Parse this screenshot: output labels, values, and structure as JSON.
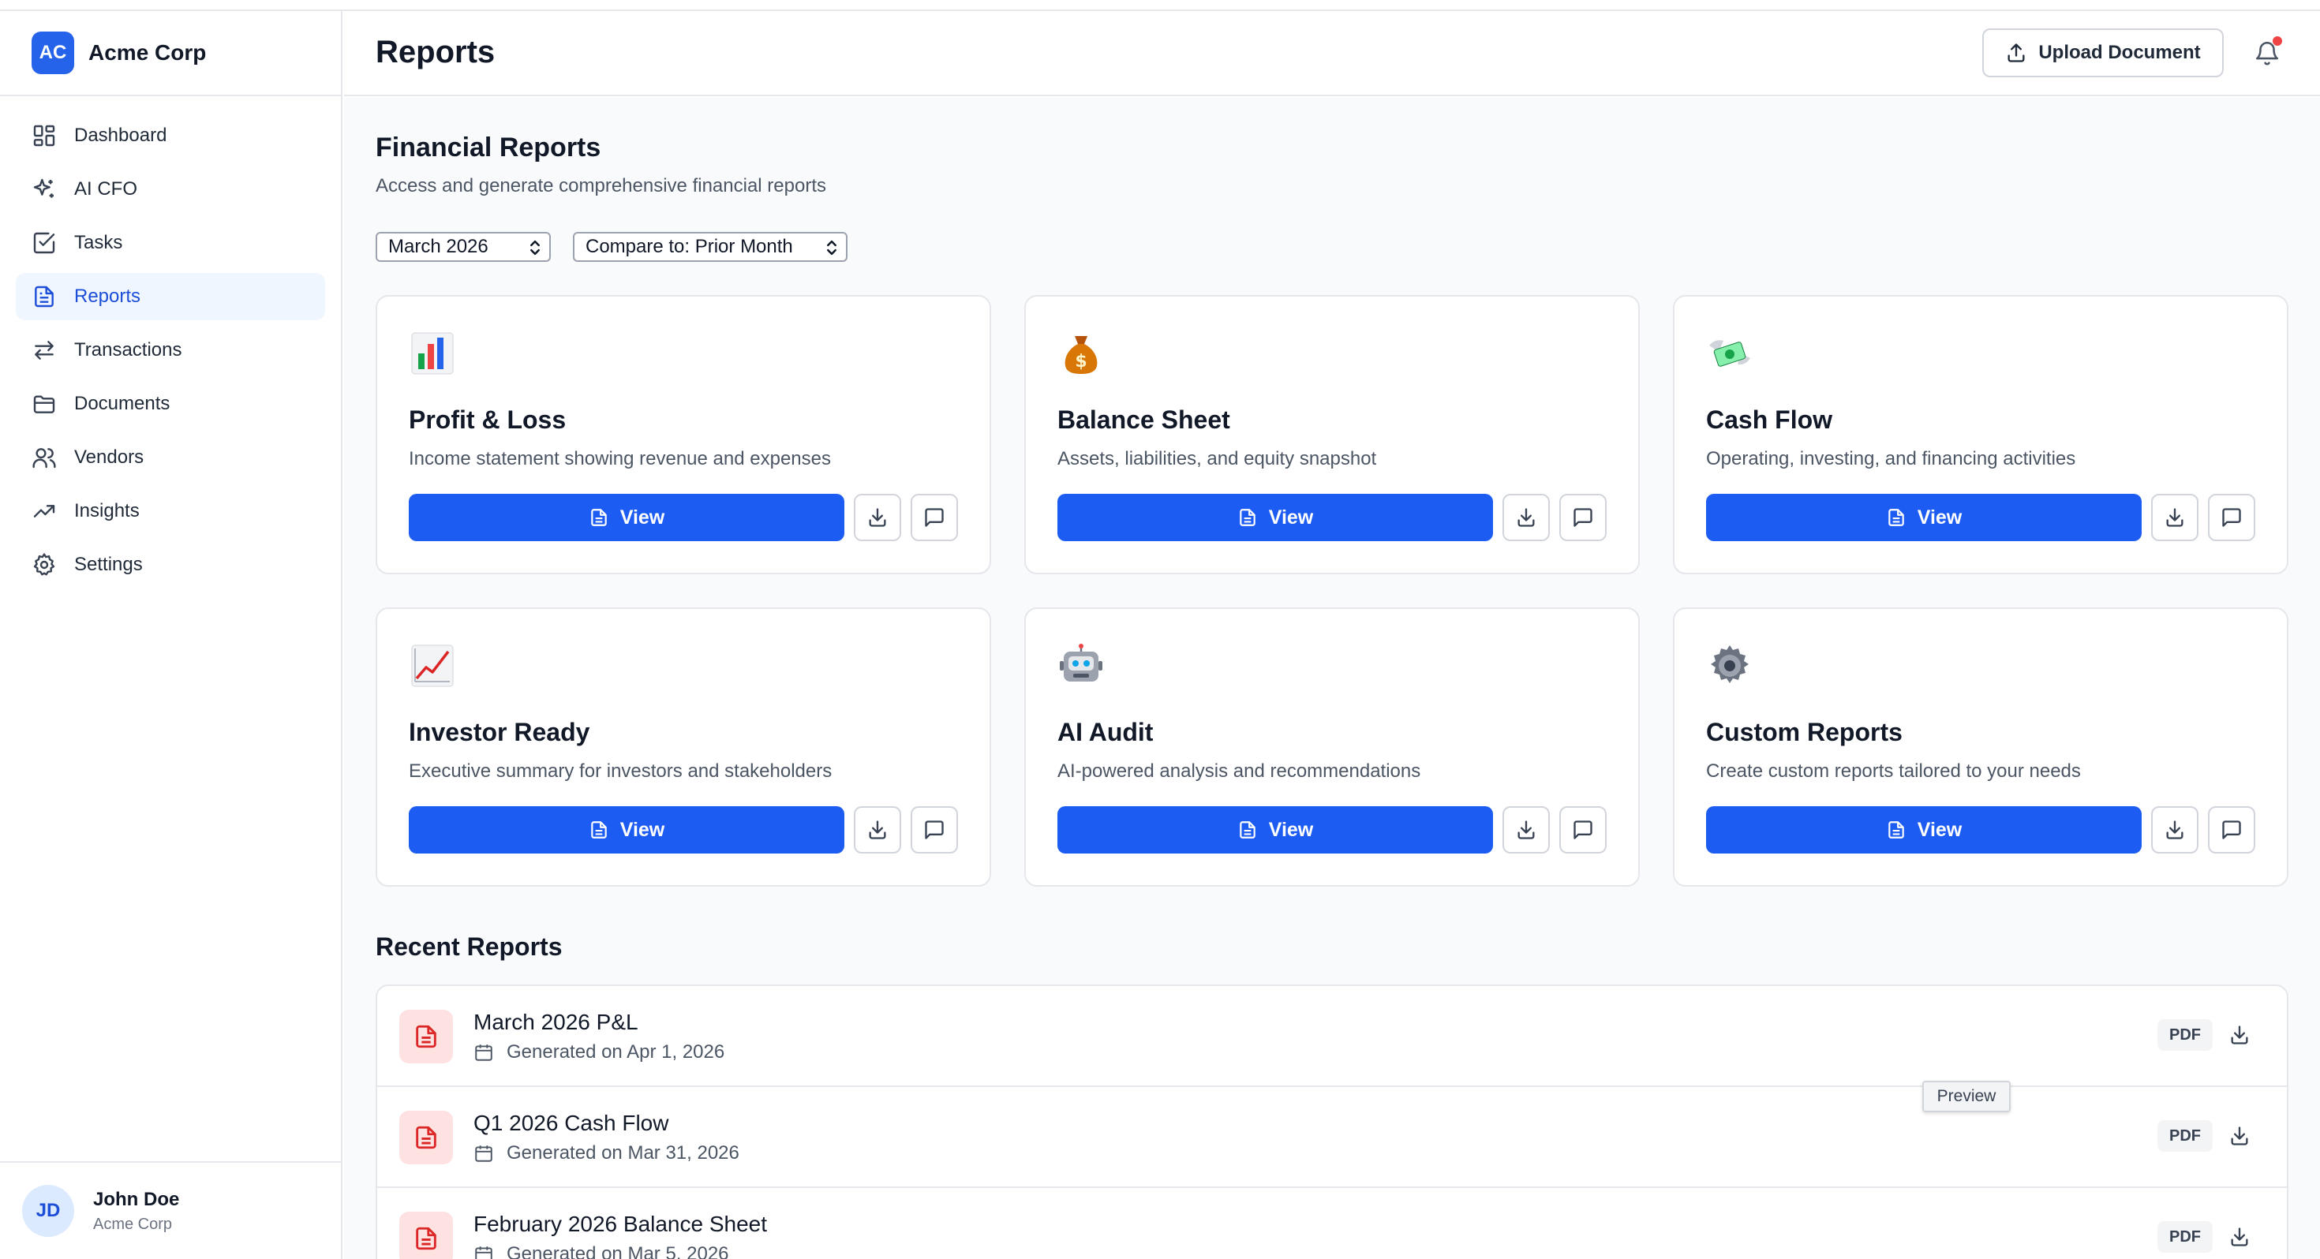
{
  "sidebar": {
    "logo_text": "AC",
    "company": "Acme Corp",
    "items": [
      {
        "label": "Dashboard",
        "icon": "dashboard-icon"
      },
      {
        "label": "AI CFO",
        "icon": "sparkles-icon"
      },
      {
        "label": "Tasks",
        "icon": "checkbox-icon"
      },
      {
        "label": "Reports",
        "icon": "file-text-icon",
        "active": true
      },
      {
        "label": "Transactions",
        "icon": "arrows-swap-icon"
      },
      {
        "label": "Documents",
        "icon": "folder-icon"
      },
      {
        "label": "Vendors",
        "icon": "users-icon"
      },
      {
        "label": "Insights",
        "icon": "trending-up-icon"
      },
      {
        "label": "Settings",
        "icon": "gear-icon"
      }
    ],
    "user": {
      "initials": "JD",
      "name": "John Doe",
      "org": "Acme Corp"
    }
  },
  "header": {
    "title": "Reports",
    "upload_label": "Upload Document"
  },
  "financial": {
    "title": "Financial Reports",
    "subtitle": "Access and generate comprehensive financial reports",
    "period_select": "March 2026",
    "compare_select": "Compare to: Prior Month"
  },
  "cards": [
    {
      "emoji": "bar-chart-emoji",
      "title": "Profit & Loss",
      "desc": "Income statement showing revenue and expenses",
      "view_label": "View"
    },
    {
      "emoji": "money-bag-emoji",
      "title": "Balance Sheet",
      "desc": "Assets, liabilities, and equity snapshot",
      "view_label": "View"
    },
    {
      "emoji": "money-wings-emoji",
      "title": "Cash Flow",
      "desc": "Operating, investing, and financing activities",
      "view_label": "View"
    },
    {
      "emoji": "chart-increasing-emoji",
      "title": "Investor Ready",
      "desc": "Executive summary for investors and stakeholders",
      "view_label": "View"
    },
    {
      "emoji": "robot-emoji",
      "title": "AI Audit",
      "desc": "AI-powered analysis and recommendations",
      "view_label": "View"
    },
    {
      "emoji": "gear-emoji",
      "title": "Custom Reports",
      "desc": "Create custom reports tailored to your needs",
      "view_label": "View"
    }
  ],
  "recent": {
    "title": "Recent Reports",
    "rows": [
      {
        "title": "March 2026 P&L",
        "meta": "Generated on Apr 1, 2026",
        "badge": "PDF"
      },
      {
        "title": "Q1 2026 Cash Flow",
        "meta": "Generated on Mar 31, 2026",
        "badge": "PDF"
      },
      {
        "title": "February 2026 Balance Sheet",
        "meta": "Generated on Mar 5, 2026",
        "badge": "PDF"
      }
    ],
    "tooltip": "Preview"
  },
  "colors": {
    "accent": "#1d5cf2",
    "active_bg": "#eff6ff",
    "notification": "#ef4444",
    "file_icon_bg": "#fee2e2"
  }
}
